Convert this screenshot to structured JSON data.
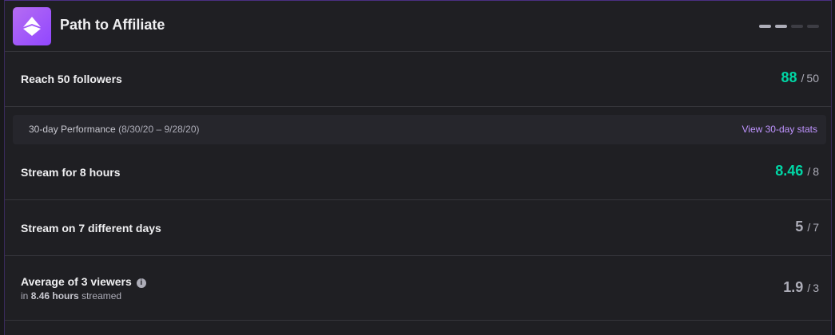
{
  "header": {
    "title": "Path to Affiliate",
    "badge_icon": "affiliate-gem-icon",
    "progress_dots_filled": 2,
    "progress_dots_total": 4
  },
  "followers": {
    "label": "Reach 50 followers",
    "value": "88",
    "separator": "/",
    "goal": "50",
    "status": "complete"
  },
  "performance": {
    "label": "30-day Performance",
    "range": "(8/30/20 – 9/28/20)",
    "link": "View 30-day stats"
  },
  "hours": {
    "label": "Stream for 8 hours",
    "value": "8.46",
    "separator": "/",
    "goal": "8",
    "status": "complete"
  },
  "days": {
    "label": "Stream on 7 different days",
    "value": "5",
    "separator": "/",
    "goal": "7",
    "status": "incomplete"
  },
  "viewers": {
    "label": "Average of 3 viewers",
    "sub_prefix": "in",
    "sub_hours": "8.46 hours",
    "sub_suffix": "streamed",
    "value": "1.9",
    "separator": "/",
    "goal": "3",
    "status": "incomplete",
    "info_icon": "info-icon"
  },
  "colors": {
    "complete": "#00d6a5",
    "incomplete": "#adadb8",
    "accent": "#9147ff",
    "link": "#bf94ff"
  }
}
